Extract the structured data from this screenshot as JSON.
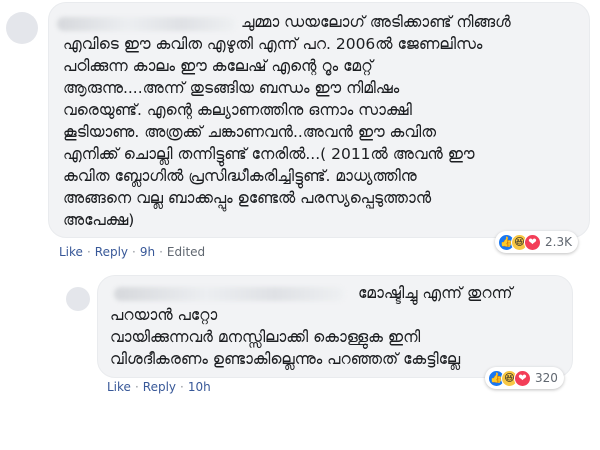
{
  "comments": [
    {
      "text": "ചുമ്മാ ഡയലോഗ് അടിക്കാണ്ട് നിങ്ങൾ\nഎവിടെ ഈ കവിത എഴുതി എന്ന് പറ. 2006ൽ ജേണലിസം\nപഠിക്കുന്ന കാലം ഈ കലേഷ് എന്റെ റൂം മേറ്റ്\nആരുന്നു....അന്ന് തുടങ്ങിയ ബന്ധം ഈ നിമിഷം\nവരെയുണ്ട്. എന്റെ കല്യാണത്തിനു ഒന്നാം സാക്ഷി\nകൂടിയാണു. അത്രക്ക് ചങ്കാണവൻ..അവൻ ഈ കവിത\nഎനിക്ക് ചൊല്ലി തന്നിട്ടുണ്ട് നേരിൽ...( 2011ൽ അവൻ ഈ\nകവിത ബ്ലോഗിൽ പ്രസിദ്ധീകരിച്ചിട്ടുണ്ട്. മാധ്യത്തിനു\nഅങ്ങനെ വല്ല ബാക്കപ്പും ഉണ്ടേൽ പരസ്യപ്പെടുത്താൻ\nഅപേക്ഷ)",
      "actions": {
        "like": "Like",
        "reply": "Reply",
        "time": "9h",
        "edited": "Edited"
      },
      "reaction_count": "2.3K",
      "reaction_icons": [
        "like",
        "haha",
        "love"
      ]
    },
    {
      "text": "മോഷ്ടിച്ചു എന്ന് തുറന്ന്\nപറയാൻ പറ്റോ\nവായിക്കുന്നവർ മനസ്സിലാക്കി കൊള്ളുക ഇനി\nവിശദീകരണം ഉണ്ടാകില്ലെന്നും പറഞ്ഞത് കേട്ടില്ലേ",
      "actions": {
        "like": "Like",
        "reply": "Reply",
        "time": "10h"
      },
      "reaction_count": "320",
      "reaction_icons": [
        "like",
        "haha",
        "love"
      ]
    }
  ],
  "separator": "·"
}
